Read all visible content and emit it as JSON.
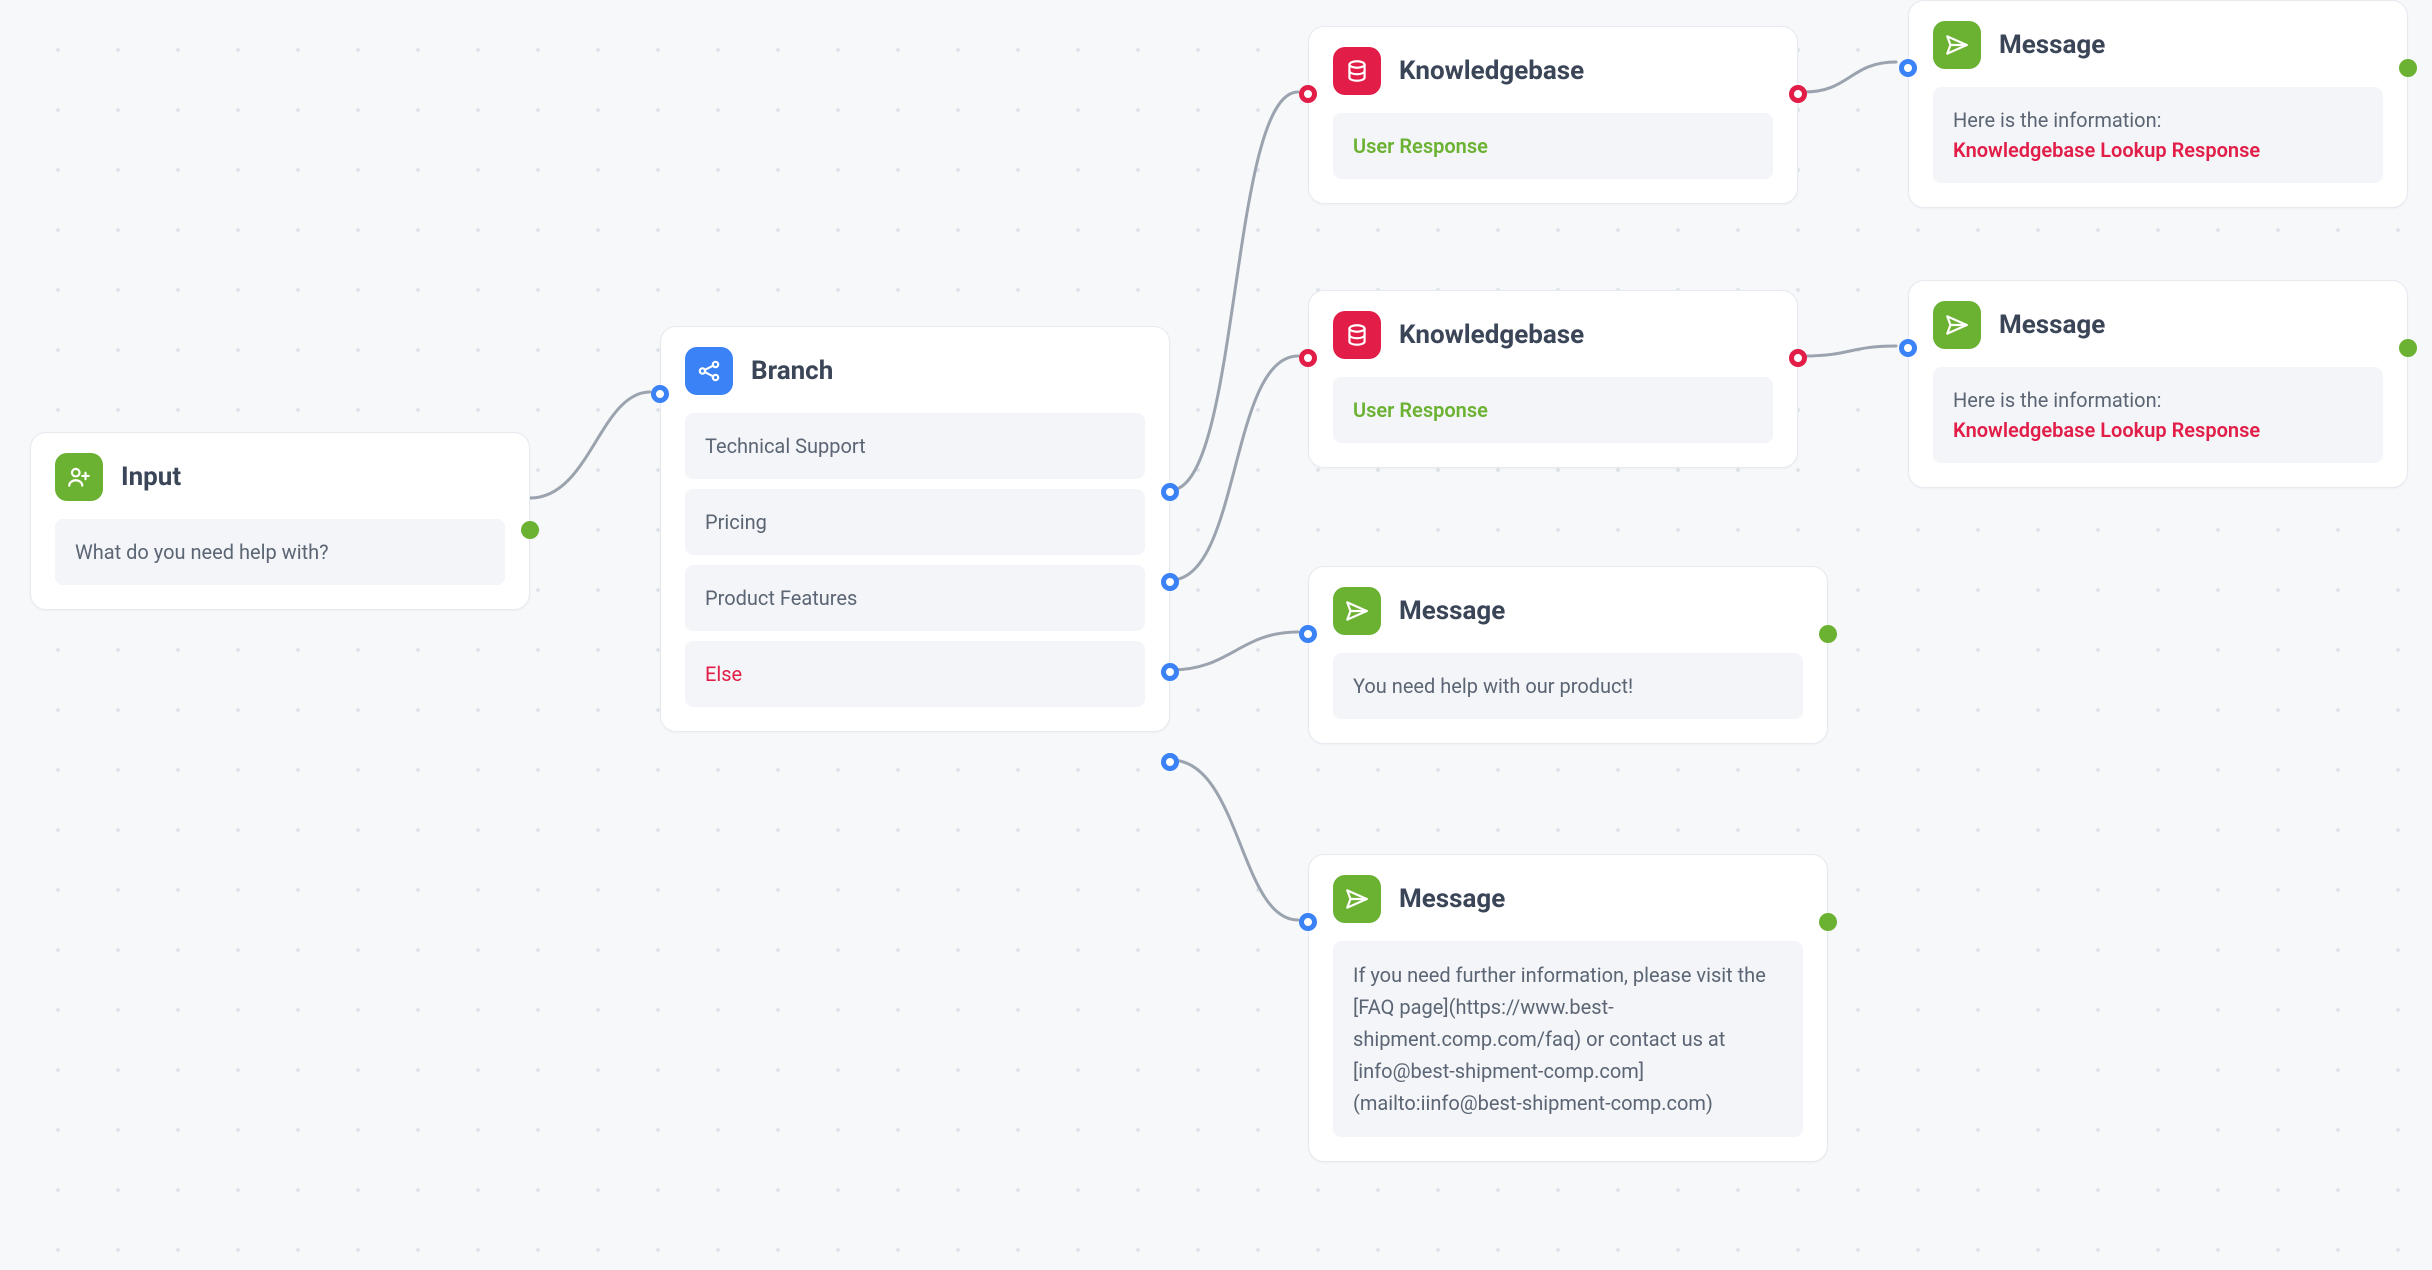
{
  "nodes": {
    "input": {
      "title": "Input",
      "body": "What do you need help with?"
    },
    "branch": {
      "title": "Branch",
      "options": [
        {
          "label": "Technical Support",
          "is_else": false
        },
        {
          "label": "Pricing",
          "is_else": false
        },
        {
          "label": "Product Features",
          "is_else": false
        },
        {
          "label": "Else",
          "is_else": true
        }
      ]
    },
    "kb1": {
      "title": "Knowledgebase",
      "body": "User Response"
    },
    "kb2": {
      "title": "Knowledgebase",
      "body": "User Response"
    },
    "msg_product": {
      "title": "Message",
      "body": "You need help with our product!"
    },
    "msg_else": {
      "title": "Message",
      "body": "If you need further information, please visit the [FAQ page](https://www.best-shipment.comp.com/faq) or contact us at [info@best-shipment-comp.com](mailto:iinfo@best-shipment-comp.com)"
    },
    "msg_kb1": {
      "title": "Message",
      "line1": "Here is the information:",
      "line2": "Knowledgebase Lookup Response"
    },
    "msg_kb2": {
      "title": "Message",
      "line1": "Here is the information:",
      "line2": "Knowledgebase Lookup Response"
    }
  }
}
